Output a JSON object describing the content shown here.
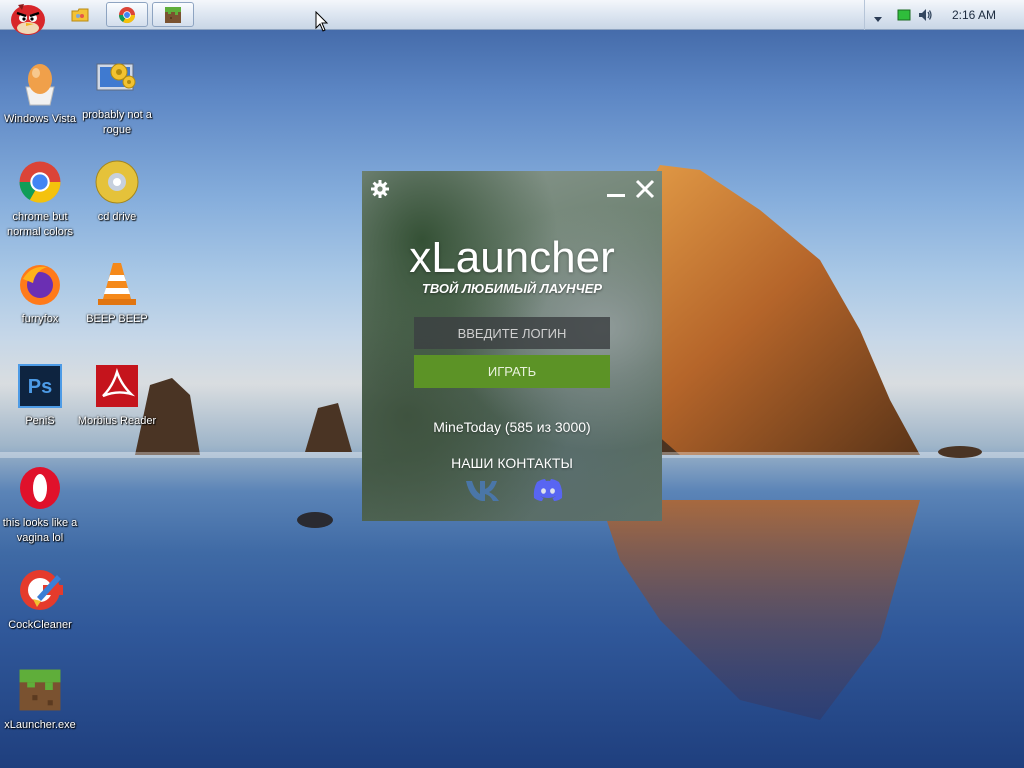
{
  "taskbar": {
    "clock": "2:16 AM",
    "tasks": [
      {
        "name": "folder",
        "icon": "folder-icon"
      },
      {
        "name": "chrome",
        "icon": "chrome-icon"
      },
      {
        "name": "minecraft",
        "icon": "minecraft-icon"
      }
    ]
  },
  "desktop_icons": [
    {
      "label": "Windows Vista",
      "icon": "egg-icon"
    },
    {
      "label": "probably not a rogue",
      "icon": "settings-monitor-icon"
    },
    {
      "label": "chrome but normal colors",
      "icon": "chrome-icon"
    },
    {
      "label": "cd drive",
      "icon": "cd-icon"
    },
    {
      "label": "furryfox",
      "icon": "firefox-icon"
    },
    {
      "label": "BEEP BEEP",
      "icon": "traffic-cone-icon"
    },
    {
      "label": "PeniS",
      "icon": "photoshop-icon"
    },
    {
      "label": "Morbius Reader",
      "icon": "pdf-reader-icon"
    },
    {
      "label": "this looks like a vagina lol",
      "icon": "opera-icon"
    },
    {
      "label": "CockCleaner",
      "icon": "ccleaner-icon"
    },
    {
      "label": "xLauncher.exe",
      "icon": "minecraft-icon"
    }
  ],
  "launcher": {
    "title": "xLauncher",
    "subtitle": "ТВОЙ ЛЮБИМЫЙ ЛАУНЧЕР",
    "login_placeholder": "ВВЕДИТЕ ЛОГИН",
    "play_label": "ИГРАТЬ",
    "server_status": "MineToday (585 из 3000)",
    "contacts_label": "НАШИ КОНТАКТЫ",
    "accent": "#5c9326"
  }
}
